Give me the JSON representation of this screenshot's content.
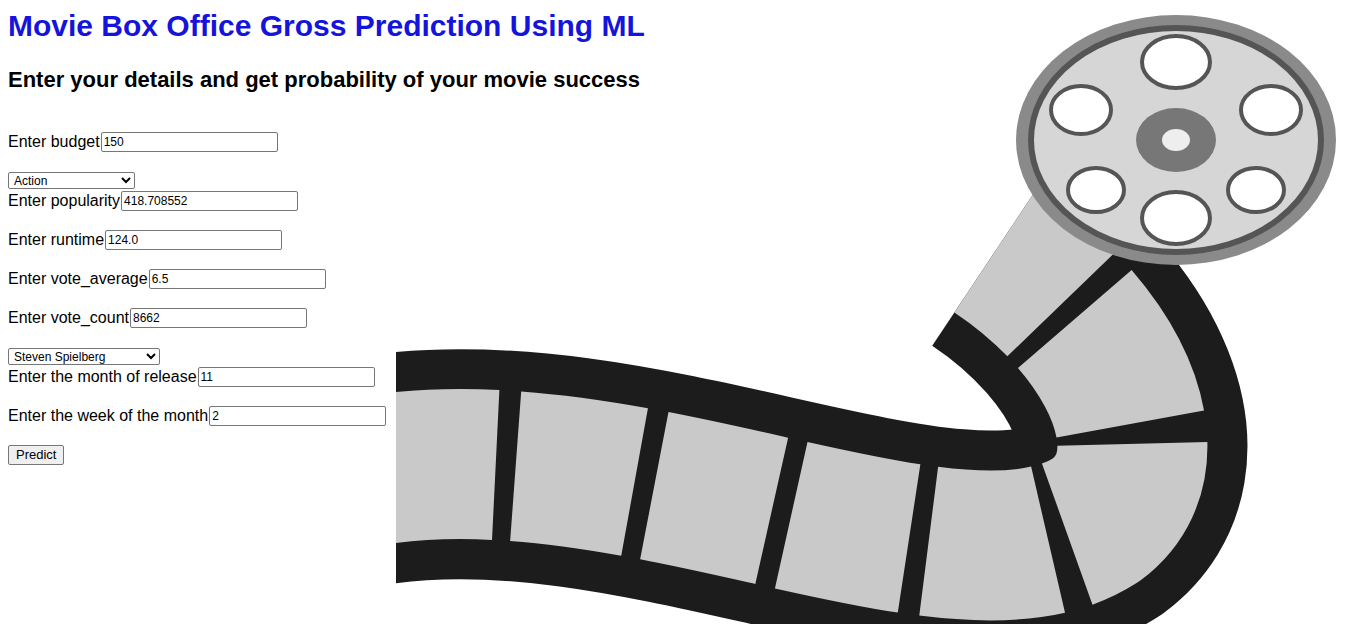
{
  "page": {
    "title": "Movie Box Office Gross Prediction Using ML",
    "subtitle": "Enter your details and get probability of your movie success"
  },
  "form": {
    "fields": [
      {
        "kind": "input",
        "label": "Enter budget",
        "value": "150"
      },
      {
        "kind": "select",
        "label": "",
        "value": "Action"
      },
      {
        "kind": "input",
        "label": "Enter popularity",
        "value": "418.708552"
      },
      {
        "kind": "input",
        "label": "Enter runtime",
        "value": "124.0"
      },
      {
        "kind": "input",
        "label": "Enter vote_average",
        "value": "6.5"
      },
      {
        "kind": "input",
        "label": "Enter vote_count",
        "value": "8662"
      },
      {
        "kind": "select",
        "label": "",
        "value": "Steven Spielberg"
      },
      {
        "kind": "input",
        "label": "Enter the month of release",
        "value": "11"
      },
      {
        "kind": "input",
        "label": "Enter the week of the month",
        "value": "2"
      }
    ],
    "submit": "Predict"
  }
}
